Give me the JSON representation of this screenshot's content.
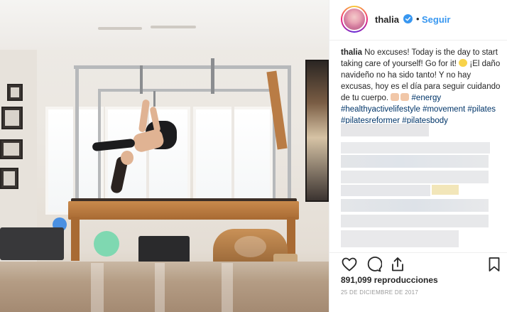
{
  "header": {
    "username": "thalia",
    "follow_label": "Seguir",
    "separator": "•",
    "verified_color": "#3897f0",
    "follow_color": "#3897f0"
  },
  "caption": {
    "author": "thalia",
    "text_1": " No excuses! Today is the day to start taking care of yourself! Go for it! ",
    "text_2": " ¡El daño navideño no ha sido tanto! Y no hay excusas, hoy es el día para seguir cuidando de tu cuerpo. ",
    "hashtags": [
      "#energy",
      "#healthyactivelifestyle",
      "#movement",
      "#pilates",
      "#pilatesreformer",
      "#pilatesbody"
    ],
    "emojis": [
      "star-emoji",
      "flexed-biceps-emoji",
      "fist-emoji"
    ]
  },
  "actions": {
    "icons": [
      "heart-icon",
      "comment-icon",
      "share-icon",
      "bookmark-icon"
    ]
  },
  "stats": {
    "views": "891,099 reproducciones",
    "date": "25 DE DICIEMBRE DE 2017"
  },
  "colors": {
    "text": "#262626",
    "hashtag": "#003569",
    "muted": "#999999",
    "border": "#efefef"
  }
}
